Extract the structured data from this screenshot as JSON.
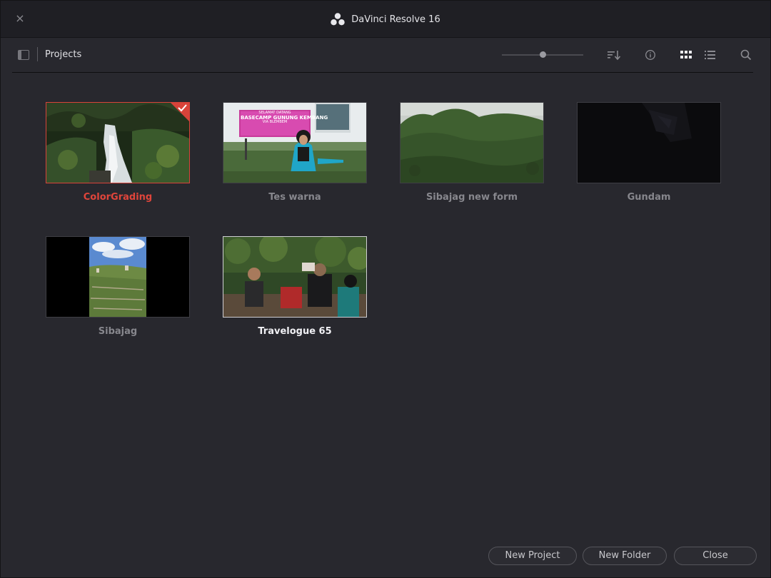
{
  "window": {
    "title": "DaVinci Resolve 16",
    "close_glyph": "×"
  },
  "toolbar": {
    "title": "Projects",
    "zoom_level": 0.5,
    "icons": [
      "sidebar-toggle-icon",
      "sort-icon",
      "info-icon",
      "grid-view-icon",
      "list-view-icon",
      "search-icon"
    ]
  },
  "projects": [
    {
      "name": "ColorGrading",
      "state": "selected"
    },
    {
      "name": "Tes warna",
      "state": "normal"
    },
    {
      "name": "Sibajag new form",
      "state": "normal"
    },
    {
      "name": "Gundam",
      "state": "normal"
    },
    {
      "name": "Sibajag",
      "state": "normal"
    },
    {
      "name": "Travelogue 65",
      "state": "current"
    }
  ],
  "thumbnail_texts": {
    "sign_line1": "SELAMAT DATANG",
    "sign_line2": "BASECAMP GUNUNG KEMBANG",
    "sign_line3": "VIA BLEMBEM"
  },
  "footer": {
    "new_project": "New Project",
    "new_folder": "New Folder",
    "close": "Close"
  },
  "colors": {
    "accent": "#d8433a",
    "background": "#28282e",
    "titlebar": "#1f1f24"
  }
}
